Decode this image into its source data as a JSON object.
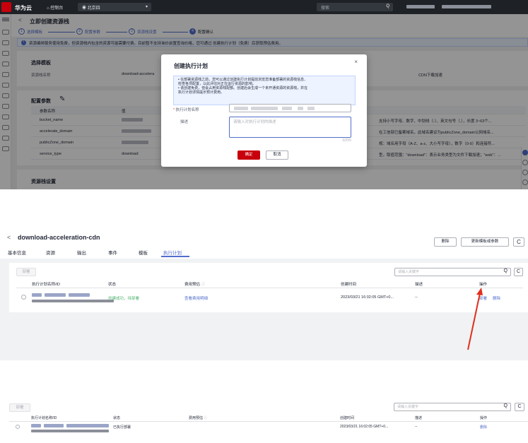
{
  "panel1": {
    "topbar": {
      "brand": "华为云",
      "console": "控制台",
      "region": "北京四",
      "search_placeholder": "搜索",
      "right_text": "..."
    },
    "header": {
      "back": "<",
      "title": "立即创建资源栈"
    },
    "steps": [
      {
        "num": "1",
        "label": "选择模板"
      },
      {
        "num": "2",
        "label": "配置参数"
      },
      {
        "num": "3",
        "label": "资源栈设置"
      },
      {
        "num": "4",
        "label": "配置确认"
      }
    ],
    "notice": "资源编排服务使用免费，但资源栈内包含的资源可能需要付费。目前暂不支持询价前置查询价格，您可通过 创建执行计划（免费）后获取预估费用。",
    "template_card": {
      "title": "选择模板",
      "label_name": "资源栈名称",
      "value_name": "download-accelera",
      "right_value": "CDN下载加速"
    },
    "params_card": {
      "title": "配置参数",
      "columns": [
        "参数名称",
        "值"
      ],
      "rows": [
        {
          "name": "bucket_name",
          "desc": "支持小写字母、数字、中划线（-）、英文句号（.），长度 3~63个..."
        },
        {
          "name": "accelerate_domain",
          "desc": "在工信部已备案域名，此域名建议为publicZone_domain公网域名..."
        },
        {
          "name": "publicZone_domain",
          "desc": "规：域名用字母（A-Z、a-z、大小写字母），数字（0-9）和连接符..."
        },
        {
          "name": "service_type",
          "value": "download",
          "desc": "型，取值范围：\"download\"：表示业务类型为文件下载加速；\"web\"：..."
        }
      ]
    },
    "stack_settings_title": "资源栈设置",
    "modal": {
      "title": "创建执行计划",
      "close": "×",
      "info_lines": [
        "• 在部署资源栈之前，您可以通过创建执行计划提前浏览您准备部署的资源栈信息、",
        "  检查各项配置，以此评估对正在运行资源的影响。",
        "• 该创建免费，但会占用资源栈配额。创建后会生成一个未开通资源的资源栈，并在",
        "  执行计划详情提示预计费用。"
      ],
      "info_bold": "但会占用资源栈配额。",
      "plan_name_label": "执行计划名称",
      "required_mark": "*",
      "desc_label": "描述",
      "desc_placeholder": "请输入对执行计划的描述",
      "counter": "0/255",
      "confirm": "确定",
      "cancel": "取消"
    }
  },
  "panel2": {
    "back": "<",
    "stack_title": "download-acceleration-cdn",
    "delete_btn": "删除",
    "update_btn": "更新模板或参数",
    "refresh": "C",
    "tabs": [
      "基本信息",
      "资源",
      "输出",
      "事件",
      "模板",
      "执行计划"
    ],
    "active_tab": "执行计划",
    "deploy_btn": "部署",
    "search_placeholder": "请输入关键字",
    "search_icon": "Q",
    "columns": [
      "执行计划名称/ID",
      "状态",
      "费用预估",
      "创建时间",
      "描述",
      "操作"
    ],
    "row": {
      "status": "创建成功，待部署",
      "cost": "查看费用明细",
      "created": "2023/03/21 16:02:05 GMT+0...",
      "desc": "--",
      "action_deploy": "部署",
      "action_delete": "删除"
    }
  },
  "panel3": {
    "deploy_btn": "部署",
    "search_placeholder": "请输入关键字",
    "search_icon": "Q",
    "refresh": "C",
    "columns": [
      "执行计划名称/ID",
      "状态",
      "费用预估",
      "创建时间",
      "描述",
      "操作"
    ],
    "row": {
      "status": "已执行部署",
      "created": "2023/03/21 16:02:05 GMT+0...",
      "desc": "--",
      "action_delete": "删除"
    }
  },
  "colors": {
    "brand_red": "#c7000b",
    "accent_blue": "#526ecc",
    "success_green": "#50b371",
    "arrow_red": "#e0301e"
  }
}
